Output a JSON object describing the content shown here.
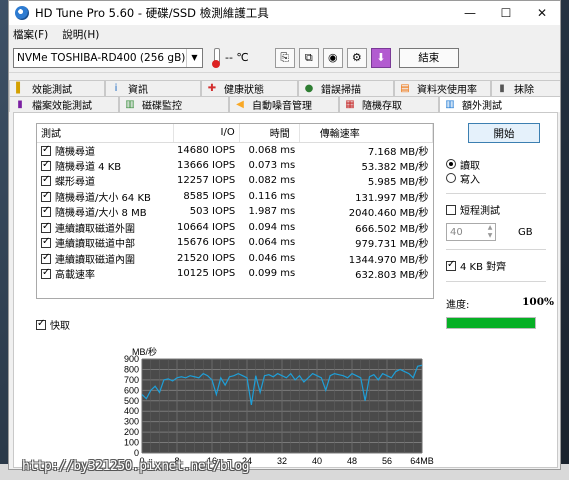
{
  "window": {
    "title": "HD Tune Pro 5.60 - 硬碟/SSD 檢測維護工具",
    "minimize": "—",
    "maximize": "☐",
    "close": "✕"
  },
  "menu": [
    "檔案(F)",
    "說明(H)"
  ],
  "toolbar": {
    "drive": "NVMe    TOSHIBA-RD400 (256 gB)",
    "temperature": "-- ℃",
    "exit_label": "結束"
  },
  "tabs_row1": [
    {
      "label": "效能測試",
      "icon": "gauge-icon",
      "glyph": "▌"
    },
    {
      "label": "資訊",
      "icon": "info-icon",
      "glyph": "i"
    },
    {
      "label": "健康狀態",
      "icon": "health-icon",
      "glyph": "✚"
    },
    {
      "label": "錯誤掃描",
      "icon": "magnifier-icon",
      "glyph": "●"
    },
    {
      "label": "資料夾使用率",
      "icon": "folder-icon",
      "glyph": "▤"
    },
    {
      "label": "抹除",
      "icon": "eraser-icon",
      "glyph": "▮"
    }
  ],
  "tabs_row2": [
    {
      "label": "檔案效能測試",
      "icon": "file-benchmark-icon",
      "glyph": "▮"
    },
    {
      "label": "磁碟監控",
      "icon": "monitor-icon",
      "glyph": "▥"
    },
    {
      "label": "自動噪音管理",
      "icon": "speaker-icon",
      "glyph": "◀"
    },
    {
      "label": "隨機存取",
      "icon": "random-access-icon",
      "glyph": "▦"
    },
    {
      "label": "額外測試",
      "icon": "extra-tests-icon",
      "glyph": "▥"
    }
  ],
  "tests": {
    "headers": {
      "name": "測試",
      "io": "I/O",
      "time": "時間",
      "rate": "傳輸速率"
    },
    "rows": [
      {
        "name": "隨機尋道",
        "io": "14680 IOPS",
        "time": "0.068 ms",
        "rate": "7.168 MB/秒"
      },
      {
        "name": "隨機尋道 4 KB",
        "io": "13666 IOPS",
        "time": "0.073 ms",
        "rate": "53.382 MB/秒"
      },
      {
        "name": "蝶形尋道",
        "io": "12257 IOPS",
        "time": "0.082 ms",
        "rate": "5.985 MB/秒"
      },
      {
        "name": "隨機尋道/大小 64 KB",
        "io": "8585 IOPS",
        "time": "0.116 ms",
        "rate": "131.997 MB/秒"
      },
      {
        "name": "隨機尋道/大小 8 MB",
        "io": "503 IOPS",
        "time": "1.987 ms",
        "rate": "2040.460 MB/秒"
      },
      {
        "name": "連續讀取磁道外圍",
        "io": "10664 IOPS",
        "time": "0.094 ms",
        "rate": "666.502 MB/秒"
      },
      {
        "name": "連續讀取磁道中部",
        "io": "15676 IOPS",
        "time": "0.064 ms",
        "rate": "979.731 MB/秒"
      },
      {
        "name": "連續讀取磁道內圍",
        "io": "21520 IOPS",
        "time": "0.046 ms",
        "rate": "1344.970 MB/秒"
      },
      {
        "name": "高載速率",
        "io": "10125 IOPS",
        "time": "0.099 ms",
        "rate": "632.803 MB/秒"
      }
    ]
  },
  "controls": {
    "start_label": "開始",
    "read_label": "讀取",
    "write_label": "寫入",
    "short_test_label": "短程測試",
    "short_test_value": "40",
    "unit_gb": "GB",
    "align_4kb_label": "4 KB 對齊",
    "progress_label": "進度:",
    "progress_value": "100%",
    "progress_fraction": 1.0
  },
  "quick_label": "快取",
  "chart_data": {
    "type": "line",
    "ylabel": "MB/秒",
    "ylim": [
      0,
      900
    ],
    "xlim": [
      0,
      64
    ],
    "yticks": [
      0,
      100,
      200,
      300,
      400,
      500,
      600,
      700,
      800,
      900
    ],
    "xticks": [
      0,
      8,
      16,
      24,
      32,
      40,
      48,
      56
    ],
    "xtick_labels": [
      "0",
      "8",
      "16",
      "24",
      "32",
      "40",
      "48",
      "56",
      "64MB"
    ],
    "grid": true,
    "series": [
      {
        "color": "#1e9fd8",
        "x": [
          0,
          1,
          2,
          3,
          4,
          5,
          6,
          7,
          8,
          9,
          10,
          11,
          12,
          13,
          14,
          15,
          16,
          17,
          18,
          19,
          20,
          21,
          22,
          23,
          24,
          25,
          26,
          27,
          28,
          29,
          30,
          31,
          32,
          33,
          34,
          35,
          36,
          37,
          38,
          39,
          40,
          41,
          42,
          43,
          44,
          45,
          46,
          47,
          48,
          49,
          50,
          51,
          52,
          53,
          54,
          55,
          56,
          57,
          58,
          59,
          60,
          61,
          62,
          63,
          64
        ],
        "y": [
          560,
          520,
          600,
          640,
          580,
          700,
          710,
          690,
          720,
          730,
          720,
          740,
          730,
          720,
          760,
          740,
          700,
          560,
          720,
          650,
          730,
          740,
          760,
          740,
          720,
          460,
          740,
          580,
          740,
          750,
          730,
          760,
          740,
          720,
          760,
          700,
          740,
          680,
          720,
          760,
          740,
          720,
          600,
          740,
          760,
          750,
          740,
          720,
          760,
          740,
          720,
          500,
          730,
          750,
          700,
          760,
          740,
          720,
          780,
          800,
          780,
          760,
          720,
          830,
          840
        ]
      }
    ]
  }
}
